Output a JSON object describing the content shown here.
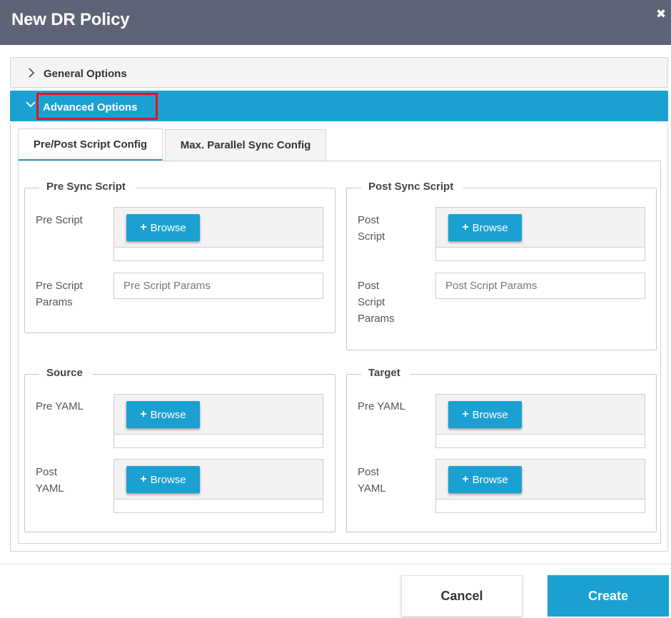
{
  "dialog": {
    "title": "New DR Policy",
    "close_icon": "close-icon"
  },
  "accordion": {
    "general": {
      "label": "General Options",
      "icon": "chevron-right-icon",
      "expanded": false
    },
    "advanced": {
      "label": "Advanced Options",
      "icon": "chevron-down-icon",
      "expanded": true,
      "highlight_color": "#e8121b"
    }
  },
  "tabs": [
    {
      "label": "Pre/Post Script Config",
      "active": true
    },
    {
      "label": "Max. Parallel Sync Config",
      "active": false
    }
  ],
  "pre_sync_script": {
    "legend": "Pre Sync Script",
    "script_label": "Pre Script",
    "browse_label": "Browse",
    "params_label_line1": "Pre Script",
    "params_label_line2": "Params",
    "params_placeholder": "Pre Script Params"
  },
  "post_sync_script": {
    "legend": "Post Sync Script",
    "script_label_line1": "Post",
    "script_label_line2": "Script",
    "browse_label": "Browse",
    "params_label_line1": "Post",
    "params_label_line2": "Script",
    "params_label_line3": "Params",
    "params_placeholder": "Post Script Params"
  },
  "source": {
    "legend": "Source",
    "pre_yaml_label": "Pre YAML",
    "post_yaml_label_line1": "Post",
    "post_yaml_label_line2": "YAML",
    "browse_label": "Browse"
  },
  "target": {
    "legend": "Target",
    "pre_yaml_label": "Pre YAML",
    "post_yaml_label_line1": "Post",
    "post_yaml_label_line2": "YAML",
    "browse_label": "Browse"
  },
  "footer": {
    "cancel_label": "Cancel",
    "create_label": "Create"
  },
  "colors": {
    "accent": "#1ba1d1",
    "titlebar": "#5d6475",
    "highlight": "#e8121b"
  }
}
